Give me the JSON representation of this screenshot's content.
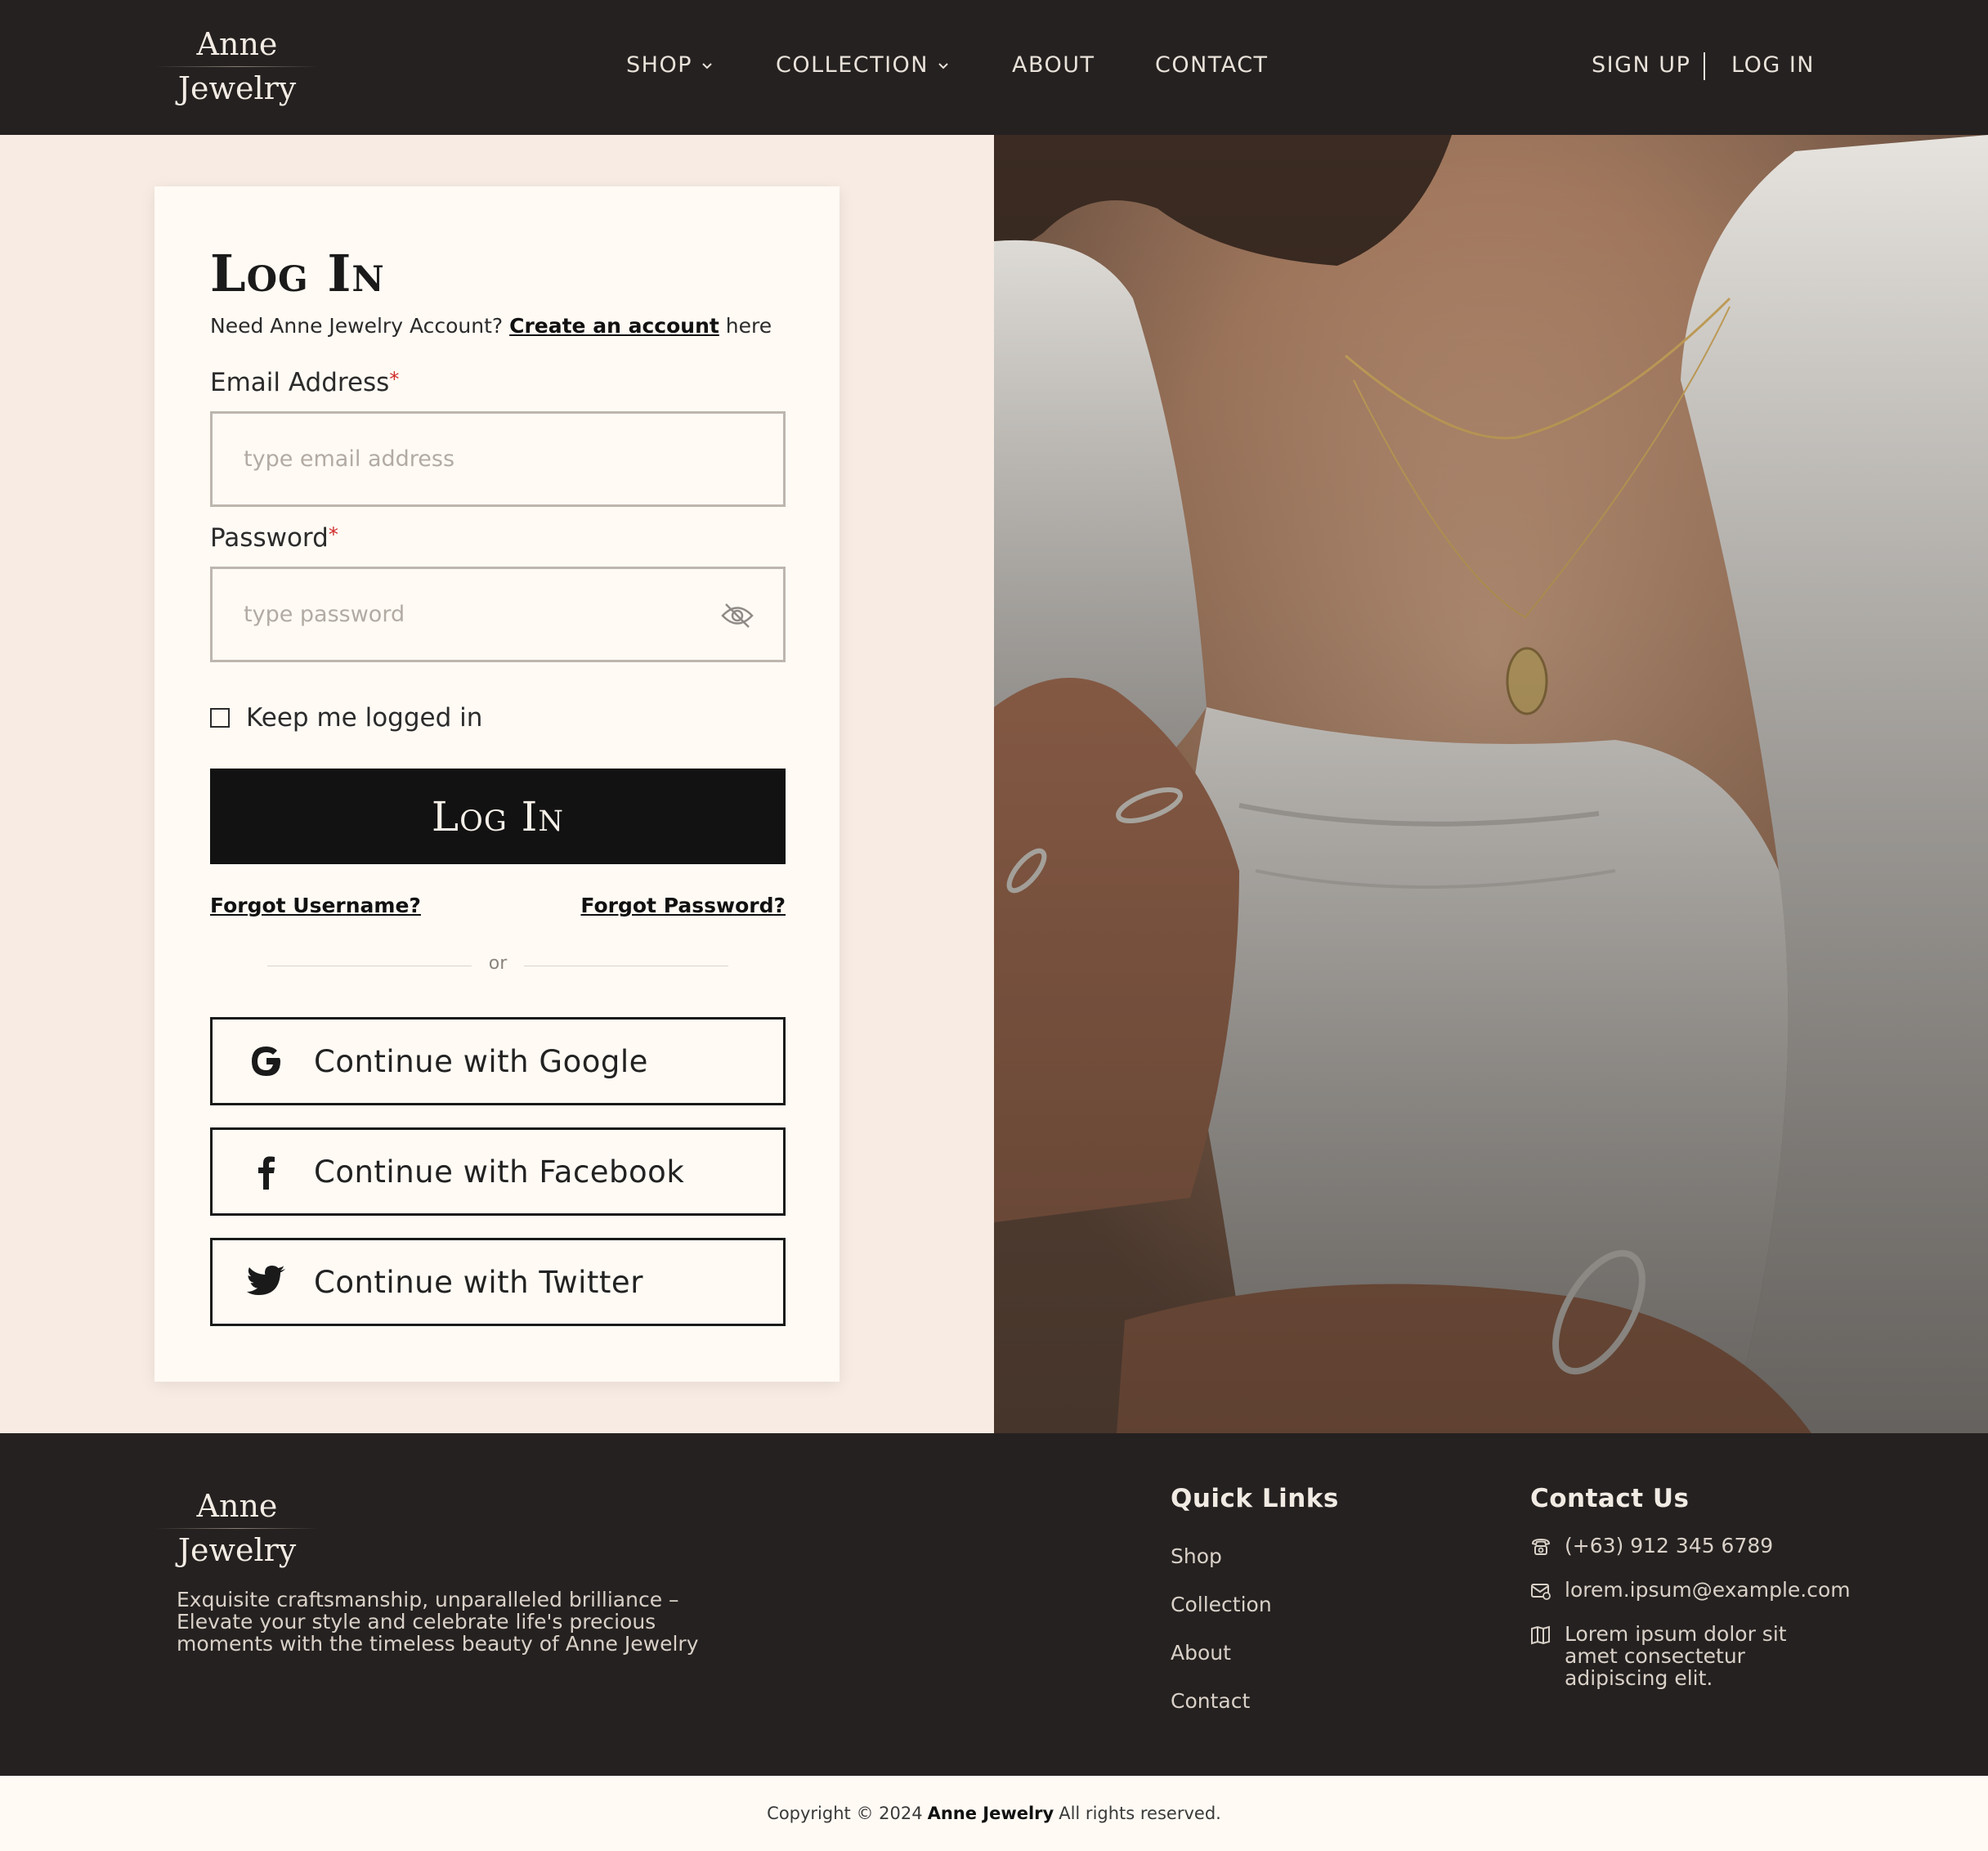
{
  "brand": {
    "line1": "Anne",
    "line2": "Jewelry"
  },
  "nav": {
    "shop": "SHOP",
    "collection": "COLLECTION",
    "about": "ABOUT",
    "contact": "CONTACT",
    "sign_up": "SIGN UP",
    "log_in": "LOG IN"
  },
  "login": {
    "title": "Log In",
    "subtitle_prefix": "Need Anne Jewelry Account? ",
    "create_link": "Create an account",
    "subtitle_suffix": " here",
    "email_label": "Email Address",
    "email_placeholder": "type email address",
    "password_label": "Password",
    "password_placeholder": "type password",
    "required_mark": "*",
    "keep_logged_in": "Keep me logged in",
    "submit": "Log In",
    "forgot_username": "Forgot Username?",
    "forgot_password": "Forgot Password?",
    "divider": "or",
    "social": [
      {
        "label": "Continue with Google",
        "icon": "google-icon"
      },
      {
        "label": "Continue with Facebook",
        "icon": "facebook-icon"
      },
      {
        "label": "Continue with Twitter",
        "icon": "twitter-icon"
      }
    ]
  },
  "footer": {
    "description": "Exquisite craftsmanship, unparalleled brilliance – Elevate your style and celebrate life's precious moments with the timeless beauty of Anne Jewelry",
    "quick_links_title": "Quick Links",
    "quick_links": [
      "Shop",
      "Collection",
      "About",
      "Contact"
    ],
    "contact_title": "Contact Us",
    "phone": "(+63) 912 345 6789",
    "email": "lorem.ipsum@example.com",
    "address": "Lorem ipsum dolor sit amet consectetur adipiscing elit."
  },
  "copyright": {
    "prefix": "Copyright © 2024",
    "brand": "Anne Jewelry",
    "suffix": "All rights reserved."
  },
  "colors": {
    "dark": "#252120",
    "card": "#fffaf4",
    "page_left": "#f7ebe3",
    "button": "#121212",
    "required": "#d02a2a"
  }
}
